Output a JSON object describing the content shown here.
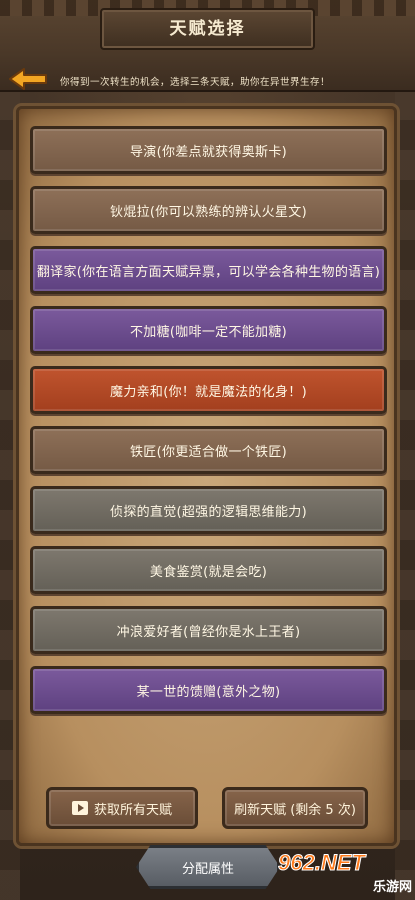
{
  "header": {
    "title": "天赋选择",
    "subtitle": "你得到一次转生的机会，选择三条天赋，助你在异世界生存！",
    "back_icon": "back-arrow-icon"
  },
  "talents": [
    {
      "label": "导演(你差点就获得奥斯卡)",
      "color": "brown"
    },
    {
      "label": "钬焜拉(你可以熟练的辨认火星文)",
      "color": "brown"
    },
    {
      "label": "翻译家(你在语言方面天赋异禀，可以学会各种生物的语言)",
      "color": "purple"
    },
    {
      "label": "不加糖(咖啡一定不能加糖)",
      "color": "purple"
    },
    {
      "label": "魔力亲和(你！就是魔法的化身！)",
      "color": "orange"
    },
    {
      "label": "铁匠(你更适合做一个铁匠)",
      "color": "brown"
    },
    {
      "label": "侦探的直觉(超强的逻辑思维能力)",
      "color": "grey"
    },
    {
      "label": "美食鉴赏(就是会吃)",
      "color": "grey"
    },
    {
      "label": "冲浪爱好者(曾经你是水上王者)",
      "color": "grey"
    },
    {
      "label": "某一世的馈赠(意外之物)",
      "color": "purple"
    }
  ],
  "buttons": {
    "get_all": "获取所有天赋",
    "refresh": "刷新天赋 (剩余 5 次)",
    "assign": "分配属性"
  },
  "watermark": {
    "logo": "962.NET",
    "sub": "乐游网"
  },
  "colors": {
    "brown": "#7d6049",
    "purple": "#6b4c8e",
    "orange": "#b5492a",
    "grey": "#6f6a61"
  }
}
